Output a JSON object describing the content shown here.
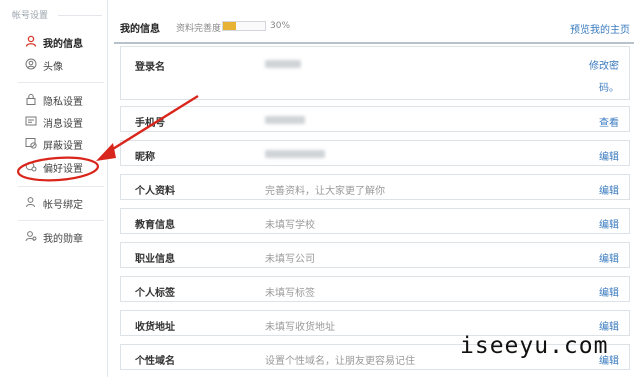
{
  "sidebar": {
    "heading": "帐号设置",
    "items": [
      {
        "label": "我的信息",
        "icon": "user-red-icon",
        "active": true
      },
      {
        "label": "头像",
        "icon": "avatar-icon",
        "active": false
      },
      {
        "label": "隐私设置",
        "icon": "lock-icon",
        "active": false
      },
      {
        "label": "消息设置",
        "icon": "message-icon",
        "active": false
      },
      {
        "label": "屏蔽设置",
        "icon": "block-icon",
        "active": false
      },
      {
        "label": "偏好设置",
        "icon": "preference-icon",
        "active": false
      },
      {
        "label": "帐号绑定",
        "icon": "bind-user-icon",
        "active": false
      },
      {
        "label": "我的勋章",
        "icon": "medal-user-icon",
        "active": false
      }
    ]
  },
  "header": {
    "title": "我的信息",
    "completion_label": "资料完善度",
    "completion_percent": "30%",
    "completion_fraction": 0.3,
    "preview_link": "预览我的主页"
  },
  "rows": [
    {
      "label": "登录名",
      "value": "",
      "action": "修改密",
      "action2": "码。"
    },
    {
      "label": "手机号",
      "value": "",
      "action": "查看"
    },
    {
      "label": "昵称",
      "value": "",
      "action": "编辑"
    },
    {
      "label": "个人资料",
      "value": "完善资料，让大家更了解你",
      "action": "编辑"
    },
    {
      "label": "教育信息",
      "value": "未填写学校",
      "action": "编辑"
    },
    {
      "label": "职业信息",
      "value": "未填写公司",
      "action": "编辑"
    },
    {
      "label": "个人标签",
      "value": "未填写标签",
      "action": "编辑"
    },
    {
      "label": "收货地址",
      "value": "未填写收货地址",
      "action": "编辑"
    },
    {
      "label": "个性域名",
      "value": "设置个性域名，让朋友更容易记住",
      "action": "编辑"
    }
  ],
  "watermark": "iseeyu.com",
  "colors": {
    "link": "#3a7bbf",
    "progress_fill": "#e8b234",
    "annotation": "#d9261c",
    "active_icon": "#d9362a"
  }
}
